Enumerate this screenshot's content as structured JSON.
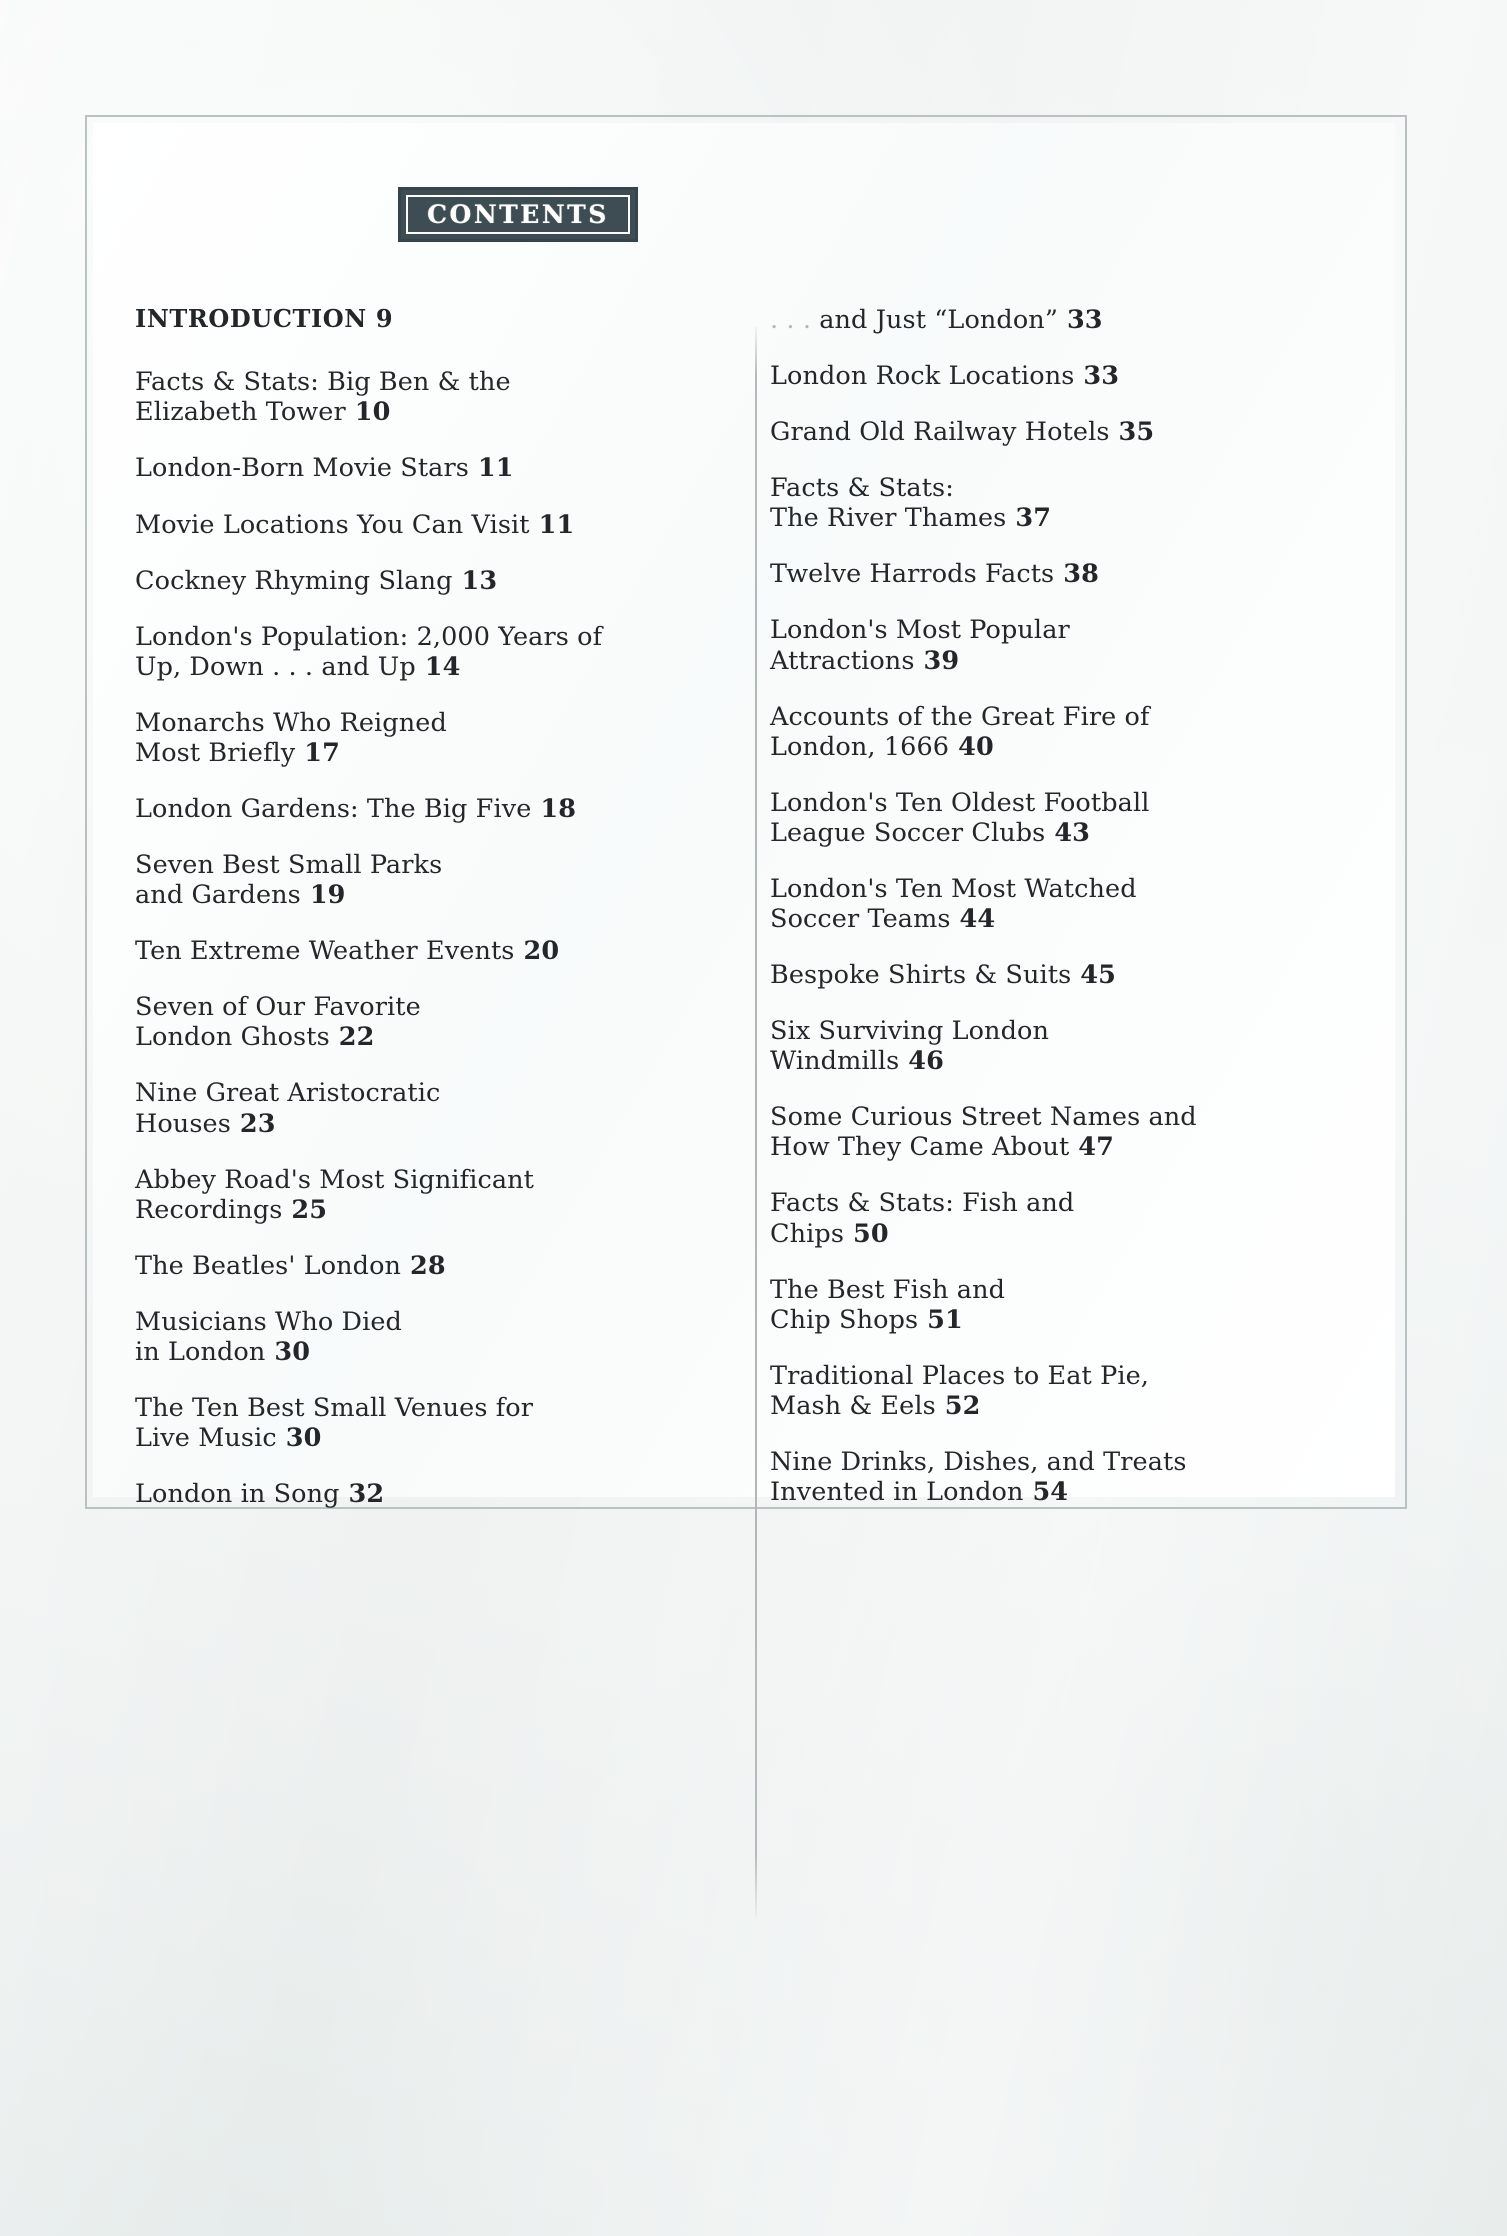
{
  "header": {
    "title": "CONTENTS"
  },
  "toc": {
    "left_column": [
      {
        "title": "INTRODUCTION",
        "page": "9",
        "section": true
      },
      {
        "title": "Facts & Stats: Big Ben & the\nElizabeth Tower",
        "page": "10"
      },
      {
        "title": "London-Born Movie Stars",
        "page": "11"
      },
      {
        "title": "Movie Locations You Can Visit",
        "page": "11"
      },
      {
        "title": "Cockney Rhyming Slang",
        "page": "13"
      },
      {
        "title": "London's Population: 2,000 Years of\nUp, Down . . . and Up",
        "page": "14"
      },
      {
        "title": "Monarchs Who Reigned\nMost Briefly",
        "page": "17"
      },
      {
        "title": "London Gardens: The Big Five",
        "page": "18"
      },
      {
        "title": "Seven Best Small Parks\nand Gardens",
        "page": "19"
      },
      {
        "title": "Ten Extreme Weather Events",
        "page": "20"
      },
      {
        "title": "Seven of Our Favorite\nLondon Ghosts",
        "page": "22"
      },
      {
        "title": "Nine Great Aristocratic\nHouses",
        "page": "23"
      },
      {
        "title": "Abbey Road's Most Significant\nRecordings",
        "page": "25"
      },
      {
        "title": "The Beatles' London",
        "page": "28"
      },
      {
        "title": "Musicians Who Died\nin London",
        "page": "30"
      },
      {
        "title": "The Ten Best Small Venues for\nLive Music",
        "page": "30"
      },
      {
        "title": "London in Song",
        "page": "32"
      }
    ],
    "right_column": [
      {
        "prefix": ". . .",
        "title": "and Just “London”",
        "page": "33"
      },
      {
        "title": "London Rock Locations",
        "page": "33"
      },
      {
        "title": "Grand Old Railway Hotels",
        "page": "35"
      },
      {
        "title": "Facts & Stats:\nThe River Thames",
        "page": "37"
      },
      {
        "title": "Twelve Harrods Facts",
        "page": "38"
      },
      {
        "title": "London's Most Popular\nAttractions",
        "page": "39"
      },
      {
        "title": "Accounts of the Great Fire of\nLondon, 1666",
        "page": "40"
      },
      {
        "title": "London's Ten Oldest Football\nLeague Soccer Clubs",
        "page": "43"
      },
      {
        "title": "London's Ten Most Watched\nSoccer Teams",
        "page": "44"
      },
      {
        "title": "Bespoke Shirts & Suits",
        "page": "45"
      },
      {
        "title": "Six Surviving London\nWindmills",
        "page": "46"
      },
      {
        "title": "Some Curious Street Names and\nHow They Came About",
        "page": "47"
      },
      {
        "title": "Facts & Stats: Fish and\nChips",
        "page": "50"
      },
      {
        "title": "The Best Fish and\nChip Shops",
        "page": "51"
      },
      {
        "title": "Traditional Places to Eat Pie,\nMash & Eels",
        "page": "52"
      },
      {
        "title": "Nine Drinks, Dishes, and Treats\nInvented in London",
        "page": "54"
      }
    ]
  }
}
